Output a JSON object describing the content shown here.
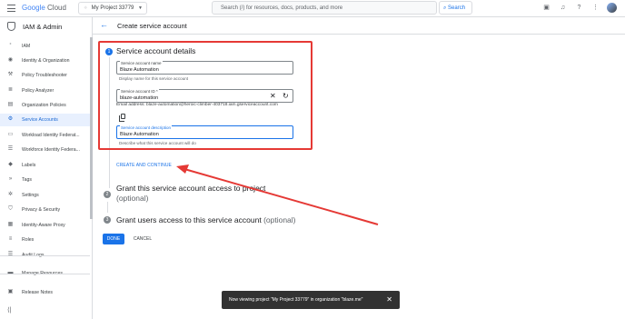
{
  "header": {
    "logo_google": "Google",
    "logo_cloud": "Cloud",
    "project": "My Project 33779",
    "search_placeholder": "Search (/) for resources, docs, products, and more",
    "search_button": "Search"
  },
  "sidebar": {
    "title": "IAM & Admin",
    "items": [
      {
        "label": "IAM",
        "icon": "person-add-icon"
      },
      {
        "label": "Identity & Organization",
        "icon": "account-circle-icon"
      },
      {
        "label": "Policy Troubleshooter",
        "icon": "wrench-icon"
      },
      {
        "label": "Policy Analyzer",
        "icon": "search-list-icon"
      },
      {
        "label": "Organization Policies",
        "icon": "document-icon"
      },
      {
        "label": "Service Accounts",
        "icon": "service-account-icon",
        "active": true
      },
      {
        "label": "Workload Identity Federat...",
        "icon": "badge-icon"
      },
      {
        "label": "Workforce Identity Federa...",
        "icon": "list-icon"
      },
      {
        "label": "Labels",
        "icon": "label-icon"
      },
      {
        "label": "Tags",
        "icon": "tag-icon"
      },
      {
        "label": "Settings",
        "icon": "gear-icon"
      },
      {
        "label": "Privacy & Security",
        "icon": "shield-icon"
      },
      {
        "label": "Identity-Aware Proxy",
        "icon": "proxy-icon"
      },
      {
        "label": "Roles",
        "icon": "roles-icon"
      },
      {
        "label": "Audit Logs",
        "icon": "list-lines-icon"
      },
      {
        "label": "Manage Resources",
        "icon": "folder-icon"
      },
      {
        "label": "Release Notes",
        "icon": "notes-icon"
      }
    ]
  },
  "page": {
    "title": "Create service account"
  },
  "step1": {
    "num": "1",
    "title": "Service account details",
    "name_label": "Service account name",
    "name_value": "Blaze Automation",
    "name_hint": "Display name for this service account",
    "id_label": "Service account ID *",
    "id_value": "blaze-automation",
    "email_line": "Email address: blaze-automation@heroic-climber-403718.iam.gserviceaccount.com",
    "desc_label": "Service account description",
    "desc_value": "Blaze Automation",
    "desc_hint": "Describe what this service account will do",
    "create_button": "CREATE AND CONTINUE"
  },
  "step2": {
    "num": "2",
    "title": "Grant this service account access to project",
    "optional": "(optional)"
  },
  "step3": {
    "num": "3",
    "title": "Grant users access to this service account",
    "optional": "(optional)"
  },
  "actions": {
    "done": "DONE",
    "cancel": "CANCEL"
  },
  "toast": {
    "message": "Now viewing project \"My Project 33779\" in organization \"blaze.me\""
  },
  "annotation": {
    "arrow_color": "#e53935",
    "box_color": "#e53935"
  }
}
